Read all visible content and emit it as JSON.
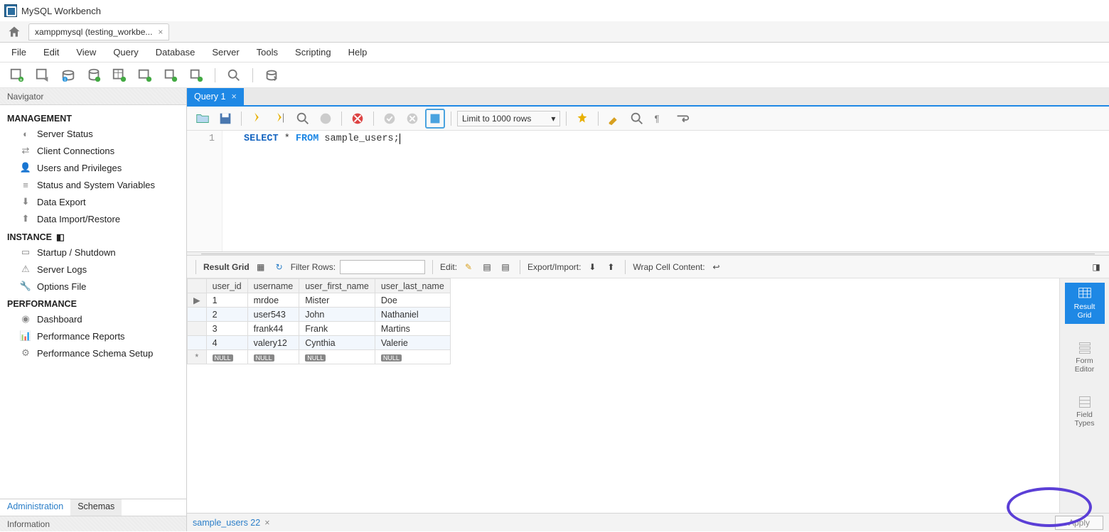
{
  "titlebar": {
    "title": "MySQL Workbench"
  },
  "connection_tab": {
    "label": "xamppmysql (testing_workbe..."
  },
  "menu": [
    "File",
    "Edit",
    "View",
    "Query",
    "Database",
    "Server",
    "Tools",
    "Scripting",
    "Help"
  ],
  "navigator": {
    "title": "Navigator"
  },
  "sidebar": {
    "management": {
      "title": "MANAGEMENT",
      "items": [
        "Server Status",
        "Client Connections",
        "Users and Privileges",
        "Status and System Variables",
        "Data Export",
        "Data Import/Restore"
      ]
    },
    "instance": {
      "title": "INSTANCE",
      "items": [
        "Startup / Shutdown",
        "Server Logs",
        "Options File"
      ]
    },
    "performance": {
      "title": "PERFORMANCE",
      "items": [
        "Dashboard",
        "Performance Reports",
        "Performance Schema Setup"
      ]
    }
  },
  "nav_tabs": {
    "administration": "Administration",
    "schemas": "Schemas"
  },
  "info_panel": "Information",
  "query_tab": {
    "label": "Query 1"
  },
  "sql_toolbar": {
    "limit": "Limit to 1000 rows"
  },
  "sql": {
    "line": "1",
    "kw_select": "SELECT",
    "star": " * ",
    "kw_from": "FROM",
    "rest": " sample_users;"
  },
  "result_toolbar": {
    "result_grid": "Result Grid",
    "filter_label": "Filter Rows:",
    "edit_label": "Edit:",
    "export_label": "Export/Import:",
    "wrap_label": "Wrap Cell Content:"
  },
  "table": {
    "columns": [
      "user_id",
      "username",
      "user_first_name",
      "user_last_name"
    ],
    "rows": [
      [
        "1",
        "mrdoe",
        "Mister",
        "Doe"
      ],
      [
        "2",
        "user543",
        "John",
        "Nathaniel"
      ],
      [
        "3",
        "frank44",
        "Frank",
        "Martins"
      ],
      [
        "4",
        "valery12",
        "Cynthia",
        "Valerie"
      ]
    ],
    "null_label": "NULL"
  },
  "right_tabs": {
    "result_grid": "Result\nGrid",
    "form_editor": "Form\nEditor",
    "field_types": "Field\nTypes"
  },
  "bottom_tab": {
    "label": "sample_users 22"
  },
  "apply_button": "Apply"
}
